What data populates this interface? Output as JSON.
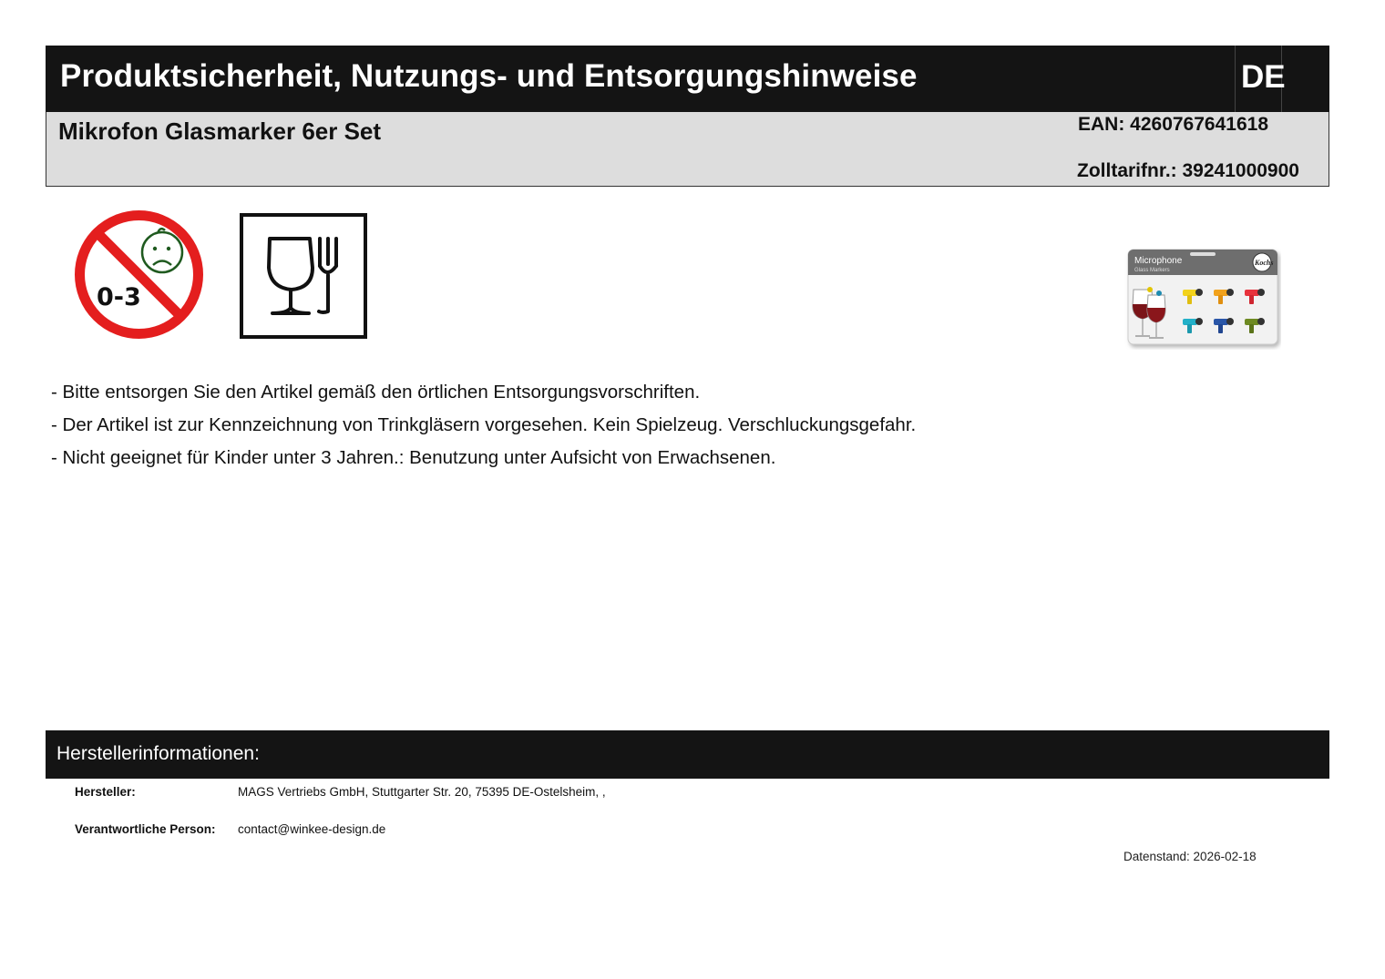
{
  "header": {
    "title": "Produktsicherheit, Nutzungs- und Entsorgungshinweise",
    "language": "DE"
  },
  "product": {
    "name": "Mikrofon Glasmarker 6er Set",
    "ean": "EAN: 4260767641618",
    "zolltarif": "Zolltarifnr.: 39241000900"
  },
  "icons": {
    "age_warning": {
      "icon": "not-for-children-0-3-icon",
      "label": "0-3"
    },
    "food_safe": {
      "icon": "glass-fork-food-safe-icon"
    }
  },
  "product_image": {
    "brand": "Kochs",
    "title": "Microphone",
    "subtitle": "Glass Markers"
  },
  "notes": [
    "- Bitte entsorgen Sie den Artikel gemäß den örtlichen Entsorgungsvorschriften.",
    "- Der Artikel ist zur Kennzeichnung von Trinkgläsern vorgesehen. Kein Spielzeug. Verschluckungsgefahr.",
    "- Nicht geeignet für Kinder unter 3 Jahren.: Benutzung unter Aufsicht von Erwachsenen."
  ],
  "manufacturer": {
    "section_title": "Herstellerinformationen:",
    "hersteller_label": "Hersteller:",
    "hersteller_value": "MAGS Vertriebs GmbH, Stuttgarter Str. 20, 75395 DE-Ostelsheim, ,",
    "person_label": "Verantwortliche Person:",
    "person_value": "contact@winkee-design.de"
  },
  "datenstand": "Datenstand: 2026-02-18",
  "colors": {
    "header_bg": "#141414",
    "subheader_bg": "#dddddd",
    "warning_red": "#e41e1e",
    "face_green": "#1f5a1f"
  }
}
